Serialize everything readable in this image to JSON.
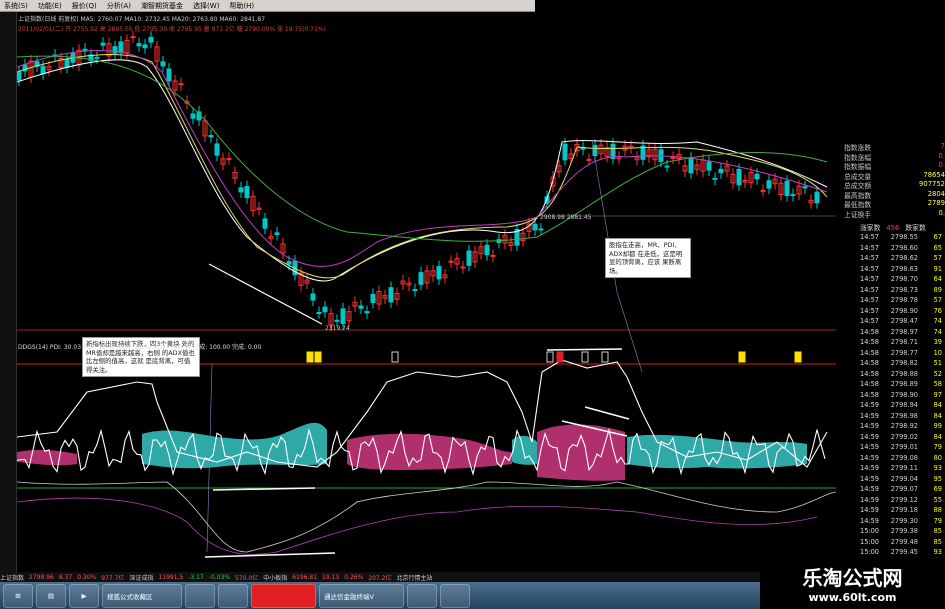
{
  "menu": [
    "系统(S)",
    "功能(E)",
    "报价(Q)",
    "分析(A)",
    "潮智期货基金",
    "",
    "选择(W)",
    "帮助(H)"
  ],
  "main_info_line": "上证指数(日线 前复权)  MA5: 2760.07  MA10: 2732.45  MA20: 2763.80  MA60: 2841.87",
  "sub_info_line": "2011/02/01(二)  开 2755.92  高 2895.05  低 2795.30  收 2795.95  量 971.2亿  幅 2790.00%  涨 19.75(0.71%)",
  "price_labels": {
    "low": "2319.74",
    "mid": "2908.98  2881.45"
  },
  "notes": {
    "left": "新指标出现持续下跌，四3个黄块 处的MR值却是越来越高，右侧 的ADX值也比左侧的值高，这就 是底背离，可值得关注。",
    "right": "股指在走高，MR、PDI、ADX却都 在走低，这是明显的顶背离，应该 果断离场。"
  },
  "indicator_header": "DDGS(14)  PDI: 30.03  MDI: 18.82  ADX: 18.49  ADXR: 49.54  完成: 100.00  完成: 0.00",
  "right_panel": {
    "rows": [
      {
        "label": "指数涨跌",
        "value": "7"
      },
      {
        "label": "指数涨幅",
        "value": "0."
      },
      {
        "label": "指数振幅",
        "value": "0."
      },
      {
        "label": "总成交量",
        "value": "78654"
      },
      {
        "label": "总成交额",
        "value": "907752"
      },
      {
        "label": "最高指数",
        "value": "2804"
      },
      {
        "label": "最低指数",
        "value": "2789"
      },
      {
        "label": "上证换手",
        "value": "0."
      }
    ],
    "tabs": [
      "涨家数",
      "456",
      "跌家数"
    ],
    "ticks": [
      [
        "14:57",
        "2798.55",
        "67"
      ],
      [
        "14:57",
        "2798.60",
        "65"
      ],
      [
        "14:57",
        "2798.62",
        "57"
      ],
      [
        "14:57",
        "2798.63",
        "91"
      ],
      [
        "14:57",
        "2798.70",
        "64"
      ],
      [
        "14:57",
        "2798.73",
        "89"
      ],
      [
        "14:57",
        "2798.78",
        "57"
      ],
      [
        "14:57",
        "2798.90",
        "76"
      ],
      [
        "14:57",
        "2798.47",
        "74"
      ],
      [
        "14:58",
        "2798.97",
        "74"
      ],
      [
        "14:58",
        "2798.71",
        "39"
      ],
      [
        "14:58",
        "2798.77",
        "10"
      ],
      [
        "14:58",
        "2798.82",
        "51"
      ],
      [
        "14:58",
        "2798.88",
        "52"
      ],
      [
        "14:58",
        "2798.89",
        "58"
      ],
      [
        "14:58",
        "2798.90",
        "97"
      ],
      [
        "14:59",
        "2798.94",
        "84"
      ],
      [
        "14:59",
        "2798.98",
        "84"
      ],
      [
        "14:59",
        "2798.92",
        "99"
      ],
      [
        "14:59",
        "2799.02",
        "84"
      ],
      [
        "14:59",
        "2799.01",
        "79"
      ],
      [
        "14:59",
        "2799.08",
        "80"
      ],
      [
        "14:59",
        "2799.11",
        "93"
      ],
      [
        "14:59",
        "2799.04",
        "95"
      ],
      [
        "14:59",
        "2799.07",
        "69"
      ],
      [
        "14:59",
        "2799.12",
        "55"
      ],
      [
        "14:59",
        "2799.18",
        "88"
      ],
      [
        "14:59",
        "2799.30",
        "79"
      ],
      [
        "15:00",
        "2799.38",
        "85"
      ],
      [
        "15:00",
        "2799.48",
        "85"
      ],
      [
        "15:00",
        "2799.45",
        "93"
      ],
      [
        "15:00",
        "2799.83",
        "10"
      ]
    ]
  },
  "status": [
    "上证指数",
    "2798.96",
    "8.37",
    "0.30%",
    "977.7亿",
    "深证成指",
    "11991.5",
    "-3.17",
    "-0.03%",
    "570.0亿",
    "中小板指",
    "6196.81",
    "19.13",
    "0.26%",
    "207.2亿",
    "北京行情主站"
  ],
  "taskbar": [
    "搜狐公式收藏区",
    "",
    "",
    "",
    "通达信金融终端V",
    "",
    ""
  ],
  "watermark": {
    "title": "乐淘公式网",
    "url": "www.60lt.com"
  },
  "colors": {
    "up": "#ff3030",
    "down": "#00c8c8",
    "ma_white": "#ffffff",
    "ma_yellow": "#e0e060",
    "ma_purple": "#c040c0",
    "ma_green": "#40b040",
    "teal_fill": "#2fa8a8",
    "magenta_fill": "#b0306e"
  }
}
